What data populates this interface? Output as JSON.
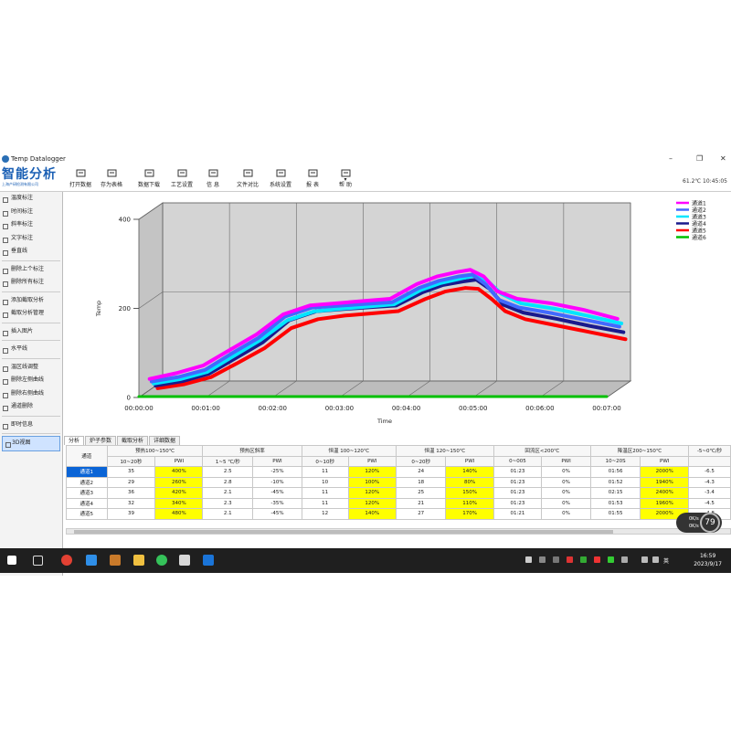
{
  "window": {
    "title": "Temp Datalogger"
  },
  "logo": {
    "main": "智能分析",
    "sub": "上海产研检测有限公司"
  },
  "toolbar": {
    "items": [
      {
        "label": "打开数据",
        "icon": "folder-icon"
      },
      {
        "label": "存为表格",
        "icon": "save-table-icon"
      },
      {
        "label": "数据下载",
        "icon": "download-icon"
      },
      {
        "label": "工艺设置",
        "icon": "gear-icon"
      },
      {
        "label": "信 息",
        "icon": "info-icon"
      },
      {
        "label": "文件对比",
        "icon": "compare-chart-icon"
      },
      {
        "label": "系统设置",
        "icon": "settings-icon"
      },
      {
        "label": "报 表",
        "icon": "printer-icon"
      },
      {
        "label": "帮 助",
        "icon": "help-icon"
      }
    ],
    "status": "61.2℃  10:45:05"
  },
  "sidebar": {
    "items": [
      {
        "label": "温度标注",
        "icon": "thermometer-icon"
      },
      {
        "label": "时间标注",
        "icon": "clock-icon"
      },
      {
        "label": "斜率标注",
        "icon": "slope-icon"
      },
      {
        "label": "文字标注",
        "icon": "text-icon"
      },
      {
        "label": "垂直线",
        "icon": "vertical-line-icon"
      },
      {
        "label": "删除上个标注",
        "icon": "trash-icon"
      },
      {
        "label": "删除所有标注",
        "icon": "trash-all-icon"
      },
      {
        "label": "添加截取分析",
        "icon": "add-analysis-icon"
      },
      {
        "label": "截取分析管理",
        "icon": "analysis-manage-icon"
      },
      {
        "label": "插入图片",
        "icon": "image-icon"
      },
      {
        "label": "水平线",
        "icon": "horizontal-line-icon"
      },
      {
        "label": "温区线调整",
        "icon": "zone-adjust-icon"
      },
      {
        "label": "删除左侧曲线",
        "icon": "delete-left-icon"
      },
      {
        "label": "删除右侧曲线",
        "icon": "delete-right-icon"
      },
      {
        "label": "通道删除",
        "icon": "channel-delete-icon"
      },
      {
        "label": "即时信息",
        "icon": "realtime-info-icon"
      },
      {
        "label": "3D视图",
        "icon": "3d-view-icon"
      }
    ]
  },
  "chart_data": {
    "type": "line",
    "xlabel": "Time",
    "ylabel": "Temp",
    "ylim": [
      0,
      400
    ],
    "yticks": [
      0,
      200,
      400
    ],
    "xlim": [
      0,
      7
    ],
    "xticks": [
      "00:00:00",
      "00:01:00",
      "00:02:00",
      "00:03:00",
      "00:04:00",
      "00:05:00",
      "00:06:00",
      "00:07:00"
    ],
    "grid": true,
    "legend_position": "top-right",
    "series": [
      {
        "name": "通道1",
        "color": "#ff00ff",
        "x": [
          0,
          0.4,
          0.8,
          1.2,
          1.6,
          2.0,
          2.4,
          2.8,
          3.2,
          3.6,
          4.0,
          4.3,
          4.6,
          4.8,
          5.0,
          5.2,
          5.5,
          6.0,
          6.5,
          7.0
        ],
        "y": [
          25,
          38,
          55,
          90,
          125,
          170,
          190,
          195,
          200,
          205,
          238,
          255,
          265,
          270,
          255,
          222,
          205,
          195,
          180,
          160
        ]
      },
      {
        "name": "通道2",
        "color": "#4169ff",
        "x": [
          0,
          0.4,
          0.8,
          1.2,
          1.6,
          2.0,
          2.4,
          2.8,
          3.2,
          3.6,
          4.0,
          4.3,
          4.6,
          4.8,
          5.0,
          5.2,
          5.5,
          6.0,
          6.5,
          7.0
        ],
        "y": [
          22,
          32,
          48,
          85,
          120,
          168,
          188,
          192,
          196,
          200,
          232,
          248,
          258,
          262,
          240,
          205,
          188,
          175,
          160,
          145
        ]
      },
      {
        "name": "通道3",
        "color": "#00e5ff",
        "x": [
          0,
          0.4,
          0.8,
          1.2,
          1.6,
          2.0,
          2.4,
          2.8,
          3.2,
          3.6,
          4.0,
          4.3,
          4.6,
          4.8,
          5.0,
          5.2,
          5.5,
          6.0,
          6.5,
          7.0
        ],
        "y": [
          20,
          30,
          46,
          82,
          118,
          162,
          182,
          188,
          193,
          198,
          230,
          246,
          256,
          262,
          250,
          222,
          200,
          188,
          172,
          155
        ]
      },
      {
        "name": "通道4",
        "color": "#1a1a8c",
        "x": [
          0,
          0.4,
          0.8,
          1.2,
          1.6,
          2.0,
          2.4,
          2.8,
          3.2,
          3.6,
          4.0,
          4.3,
          4.6,
          4.8,
          5.0,
          5.2,
          5.5,
          6.0,
          6.5,
          7.0
        ],
        "y": [
          18,
          28,
          45,
          80,
          115,
          165,
          185,
          190,
          194,
          198,
          228,
          244,
          252,
          256,
          235,
          200,
          182,
          168,
          152,
          138
        ]
      },
      {
        "name": "通道5",
        "color": "#ff0000",
        "x": [
          0,
          0.4,
          0.8,
          1.2,
          1.6,
          2.0,
          2.4,
          2.8,
          3.2,
          3.6,
          4.0,
          4.3,
          4.6,
          4.8,
          5.0,
          5.2,
          5.5,
          6.0,
          6.5,
          7.0
        ],
        "y": [
          15,
          24,
          40,
          72,
          105,
          150,
          170,
          178,
          183,
          188,
          215,
          232,
          240,
          238,
          215,
          188,
          170,
          155,
          140,
          125
        ]
      },
      {
        "name": "通道6",
        "color": "#00c000",
        "x": [
          0,
          7
        ],
        "y": [
          0,
          0
        ]
      }
    ]
  },
  "tabs": [
    "分析",
    "炉子参数",
    "截取分析",
    "详细数据"
  ],
  "table": {
    "group_headers": [
      "通道",
      "预热100~150℃",
      "预热区斜率",
      "恒温 100~120℃",
      "恒温 120~150℃",
      "回流区<200℃",
      "降温区200~150℃",
      "-5~0℃/秒"
    ],
    "sub_headers": [
      "10~20秒",
      "PWI",
      "1~5 ℃/秒",
      "PWI",
      "0~10秒",
      "PWI",
      "0~20秒",
      "PWI",
      "0~005",
      "PWI",
      "10~20S",
      "PWI"
    ],
    "rows": [
      {
        "name": "通道1",
        "cells": [
          "35",
          "400%",
          "2.5",
          "-25%",
          "11",
          "120%",
          "24",
          "140%",
          "01:23",
          "0%",
          "01:56",
          "2000%",
          "-6.5"
        ]
      },
      {
        "name": "通道2",
        "cells": [
          "29",
          "260%",
          "2.8",
          "-10%",
          "10",
          "100%",
          "18",
          "80%",
          "01:23",
          "0%",
          "01:52",
          "1940%",
          "-4.3"
        ]
      },
      {
        "name": "通道3",
        "cells": [
          "36",
          "420%",
          "2.1",
          "-45%",
          "11",
          "120%",
          "25",
          "150%",
          "01:23",
          "0%",
          "02:15",
          "2400%",
          "-3.4"
        ]
      },
      {
        "name": "通道4",
        "cells": [
          "32",
          "340%",
          "2.3",
          "-35%",
          "11",
          "120%",
          "21",
          "110%",
          "01:23",
          "0%",
          "01:53",
          "1960%",
          "-4.5"
        ]
      },
      {
        "name": "通道5",
        "cells": [
          "39",
          "480%",
          "2.1",
          "-45%",
          "12",
          "140%",
          "27",
          "170%",
          "01:21",
          "0%",
          "01:55",
          "2000%",
          "-4.8"
        ]
      }
    ],
    "yellow_columns": [
      1,
      5,
      7,
      11
    ]
  },
  "gauge": {
    "percent": "79",
    "up": "0K/s",
    "down": "0K/s"
  },
  "taskbar": {
    "time": "16:59",
    "date": "2023/9/17",
    "ime": "英"
  }
}
